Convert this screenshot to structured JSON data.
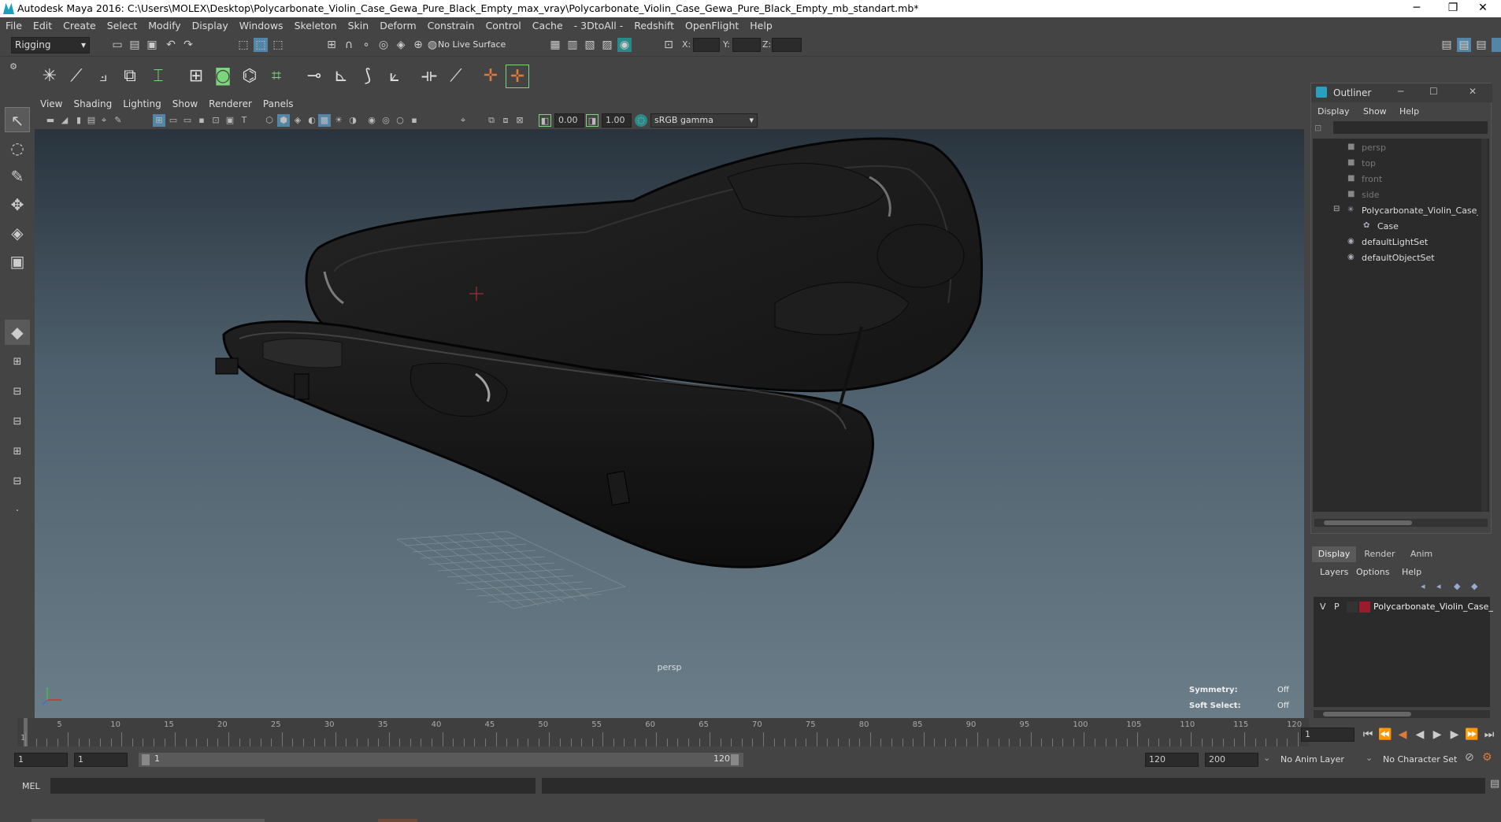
{
  "window": {
    "title": "Autodesk Maya 2016: C:\\Users\\MOLEX\\Desktop\\Polycarbonate_Violin_Case_Gewa_Pure_Black_Empty_max_vray\\Polycarbonate_Violin_Case_Gewa_Pure_Black_Empty_mb_standart.mb*",
    "minimize": "─",
    "restore": "❐",
    "close": "✕"
  },
  "menubar": [
    "File",
    "Edit",
    "Create",
    "Select",
    "Modify",
    "Display",
    "Windows",
    "Skeleton",
    "Skin",
    "Deform",
    "Constrain",
    "Control",
    "Cache",
    "- 3DtoAll -",
    "Redshift",
    "OpenFlight",
    "Help"
  ],
  "statusline": {
    "menuset": "Rigging",
    "live_surface": "No Live Surface",
    "x_label": "X:",
    "y_label": "Y:",
    "z_label": "Z:"
  },
  "panel_menu": [
    "View",
    "Shading",
    "Lighting",
    "Show",
    "Renderer",
    "Panels"
  ],
  "panel_bar": {
    "near_value": "0.00",
    "far_value": "1.00",
    "color_space": "sRGB gamma"
  },
  "viewport": {
    "camera_label": "persp",
    "symmetry_label": "Symmetry:",
    "symmetry_value": "Off",
    "soft_select_label": "Soft Select:",
    "soft_select_value": "Off"
  },
  "outliner": {
    "title": "Outliner",
    "menu": [
      "Display",
      "Show",
      "Help"
    ],
    "items": [
      {
        "label": "persp",
        "icon": "camera-icon",
        "indent": 0,
        "dim": true
      },
      {
        "label": "top",
        "icon": "camera-icon",
        "indent": 0,
        "dim": true
      },
      {
        "label": "front",
        "icon": "camera-icon",
        "indent": 0,
        "dim": true
      },
      {
        "label": "side",
        "icon": "camera-icon",
        "indent": 0,
        "dim": true
      },
      {
        "label": "Polycarbonate_Violin_Case_G",
        "icon": "group-icon",
        "indent": 0,
        "dim": false
      },
      {
        "label": "Case",
        "icon": "mesh-icon",
        "indent": 1,
        "dim": false
      },
      {
        "label": "defaultLightSet",
        "icon": "set-icon",
        "indent": 0,
        "dim": false
      },
      {
        "label": "defaultObjectSet",
        "icon": "set-icon",
        "indent": 0,
        "dim": false
      }
    ]
  },
  "layer_panel": {
    "tabs": [
      "Display",
      "Render",
      "Anim"
    ],
    "menu": [
      "Layers",
      "Options",
      "Help"
    ],
    "layer": {
      "v": "V",
      "p": "P",
      "name": "Polycarbonate_Violin_Case_",
      "color": "#9b1b2e"
    }
  },
  "timeline": {
    "ticks": [
      "1",
      "5",
      "10",
      "15",
      "20",
      "25",
      "30",
      "35",
      "40",
      "45",
      "50",
      "55",
      "60",
      "65",
      "70",
      "75",
      "80",
      "85",
      "90",
      "95",
      "100",
      "105",
      "110",
      "115",
      "120"
    ],
    "current_frame": "1"
  },
  "range": {
    "start": "1",
    "current": "1",
    "slider_start": "1",
    "slider_end": "120",
    "end": "120",
    "max_end": "200",
    "anim_layer": "No Anim Layer",
    "character_set": "No Character Set"
  },
  "cmdline": {
    "label": "MEL"
  },
  "colors": {
    "accent": "#5285a6",
    "active_tool": "#6b8fb5",
    "layer_color": "#9b1b2e"
  }
}
